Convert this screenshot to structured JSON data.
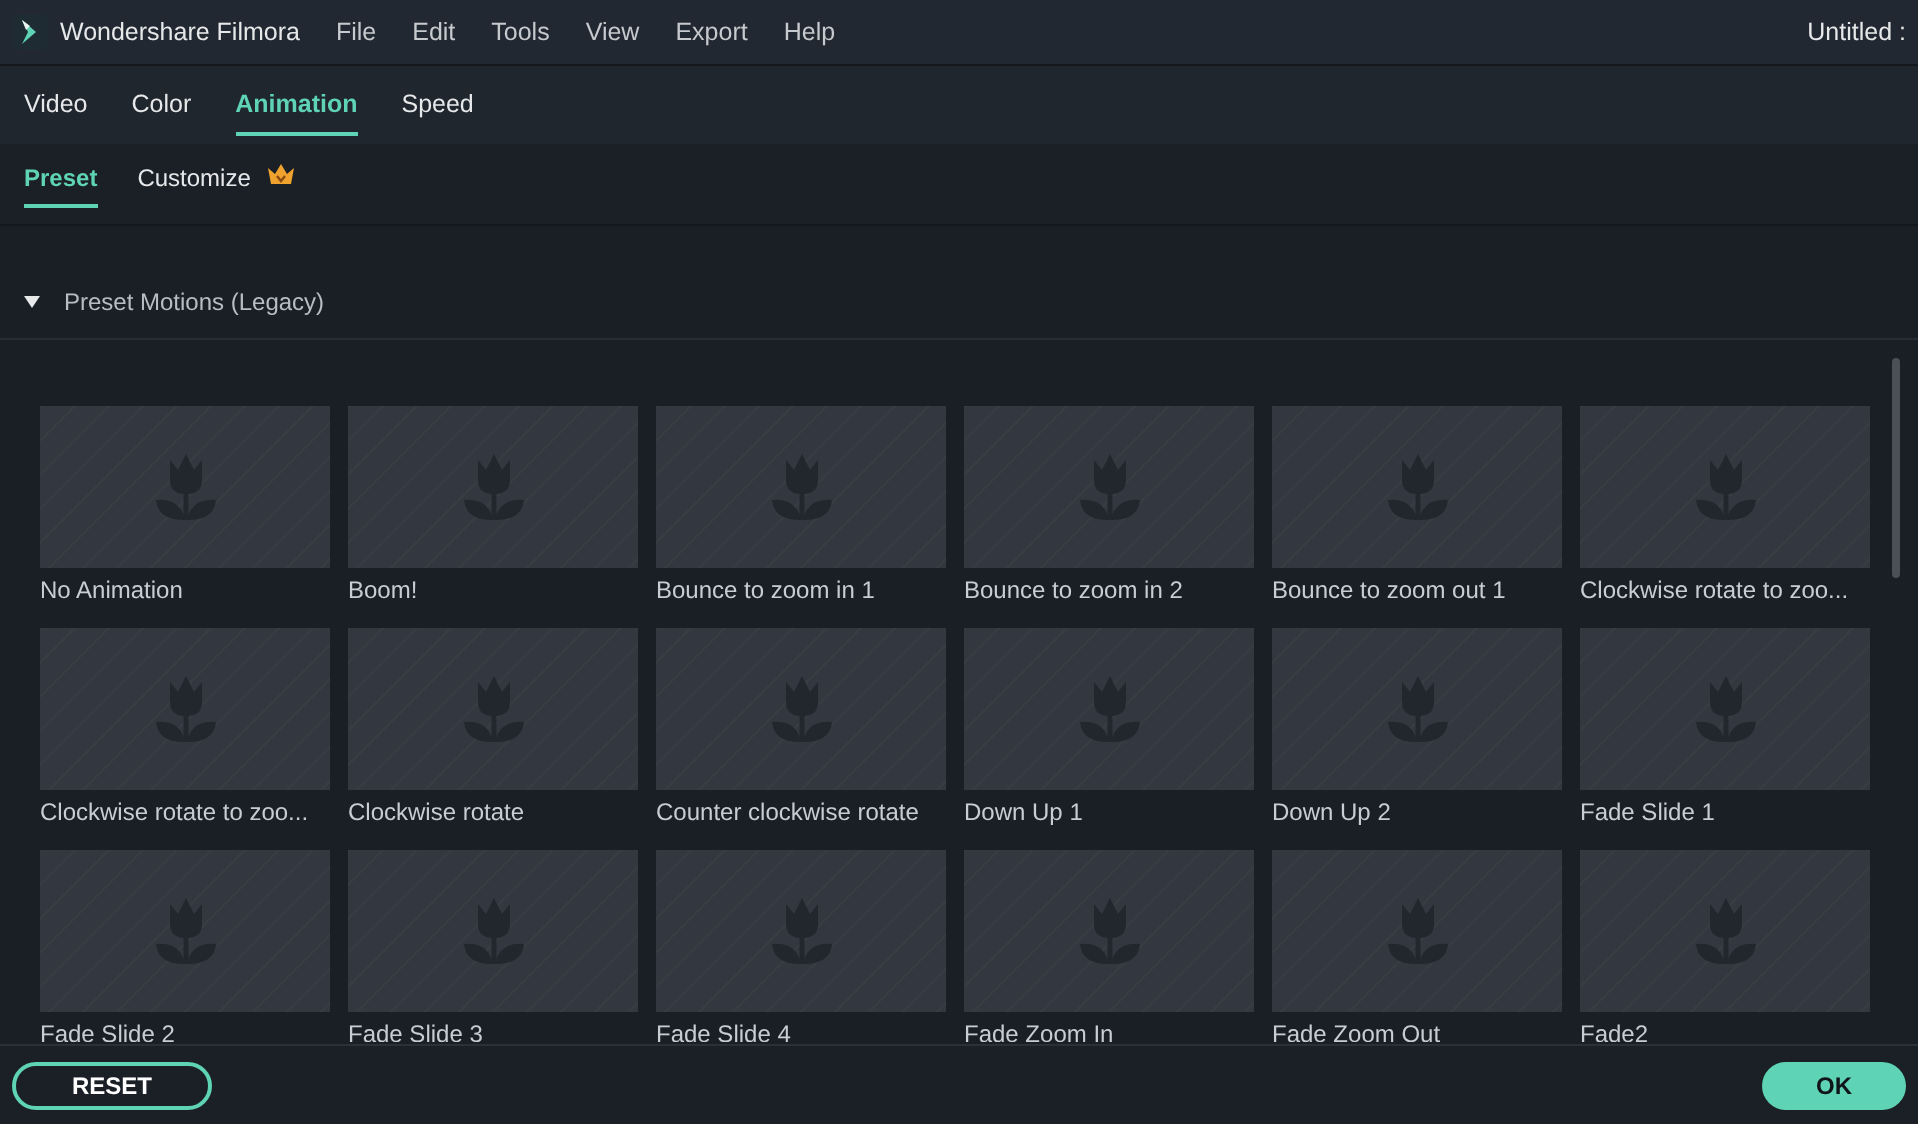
{
  "window": {
    "app_name": "Wondershare Filmora",
    "menu": [
      "File",
      "Edit",
      "Tools",
      "View",
      "Export",
      "Help"
    ],
    "title": "Untitled :"
  },
  "tabs": [
    {
      "label": "Video",
      "selected": false
    },
    {
      "label": "Color",
      "selected": false
    },
    {
      "label": "Animation",
      "selected": true
    },
    {
      "label": "Speed",
      "selected": false
    }
  ],
  "subtabs": [
    {
      "label": "Preset",
      "selected": true,
      "premium": false
    },
    {
      "label": "Customize",
      "selected": false,
      "premium": true
    }
  ],
  "section": {
    "title": "Preset Motions (Legacy)",
    "expanded": true
  },
  "presets": [
    {
      "label": "No Animation"
    },
    {
      "label": "Boom!"
    },
    {
      "label": "Bounce to zoom in 1"
    },
    {
      "label": "Bounce to zoom in 2"
    },
    {
      "label": "Bounce to zoom out 1"
    },
    {
      "label": "Clockwise rotate to zoo..."
    },
    {
      "label": "Clockwise rotate to zoo..."
    },
    {
      "label": "Clockwise rotate"
    },
    {
      "label": "Counter clockwise rotate"
    },
    {
      "label": "Down Up 1"
    },
    {
      "label": "Down Up 2"
    },
    {
      "label": "Fade Slide 1"
    },
    {
      "label": "Fade Slide 2"
    },
    {
      "label": "Fade Slide 3"
    },
    {
      "label": "Fade Slide 4"
    },
    {
      "label": "Fade Zoom In"
    },
    {
      "label": "Fade Zoom Out"
    },
    {
      "label": "Fade2"
    }
  ],
  "buttons": {
    "reset": "RESET",
    "ok": "OK"
  }
}
